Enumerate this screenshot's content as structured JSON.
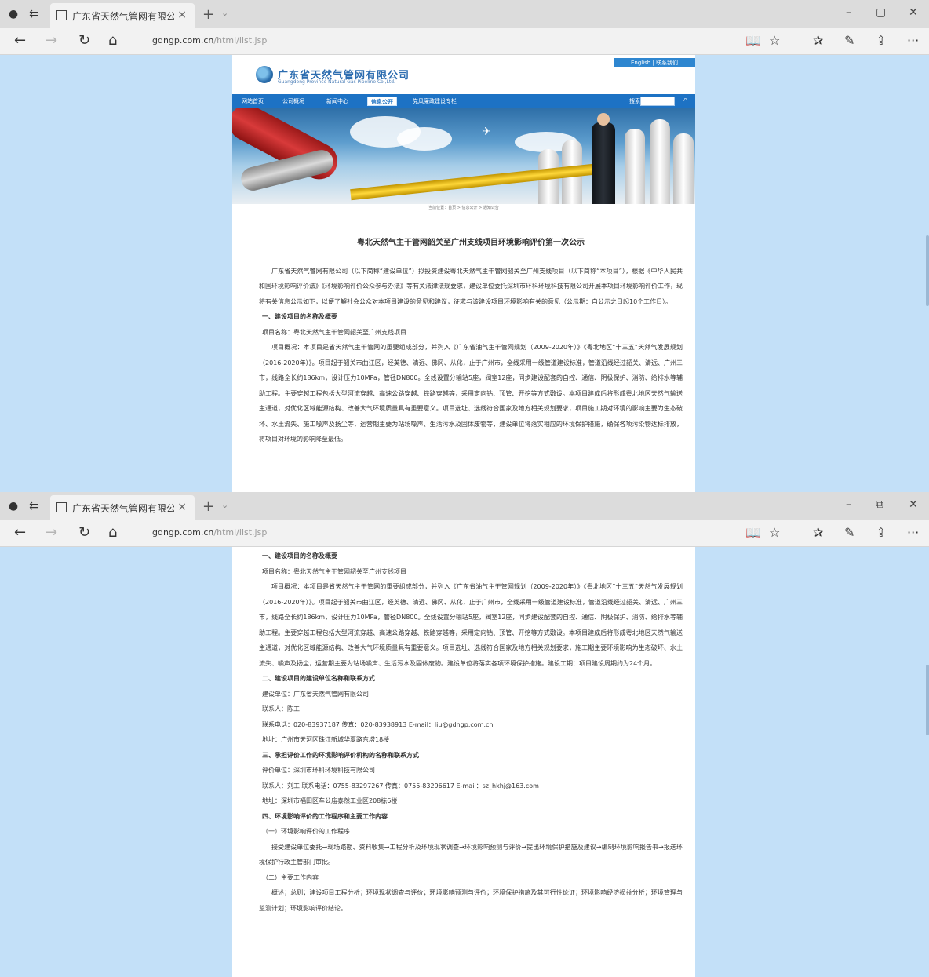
{
  "browser": {
    "tab_title": "广东省天然气管网有限公司",
    "tab_close": "×",
    "new_tab": "+",
    "tab_dropdown": "⌄",
    "url_host": "gdngp.com.cn",
    "url_path": "/html/list.jsp",
    "win_minimize": "–",
    "win_restore_top": "▢",
    "win_restore_bottom": "⧉",
    "win_close": "✕",
    "more_menu": "···"
  },
  "site": {
    "company_name": "广东省天然气管网有限公司",
    "company_en": "Guangdong Province Natural Gas Pipeline Co.,Ltd.",
    "top_link": "English  |  联系我们",
    "nav": [
      "网站首页",
      "公司概况",
      "新闻中心",
      "信息公开",
      "党风廉政建设专栏"
    ],
    "search_label": "搜索",
    "banner_caption": "当前位置：首页 > 信息公开 > 通知公告"
  },
  "article": {
    "title": "粤北天然气主干管网韶关至广州支线项目环境影响评价第一次公示",
    "intro": "广东省天然气管网有限公司（以下简称“建设单位”）拟投资建设粤北天然气主干管网韶关至广州支线项目（以下简称“本项目”），根据《中华人民共和国环境影响评价法》《环境影响评价公众参与办法》等有关法律法规要求，建设单位委托深圳市环科环境科技有限公司开展本项目环境影响评价工作，现将有关信息公示如下，以便了解社会公众对本项目建设的意见和建议，征求与该建设项目环境影响有关的意见（公示期：自公示之日起10个工作日）。",
    "sec1_heading": "一、建设项目的名称及概要",
    "project_name": "项目名称：粤北天然气主干管网韶关至广州支线项目",
    "project_summary": "项目概况：本项目是省天然气主干管网的重要组成部分，并列入《广东省油气主干管网规划（2009-2020年）》《粤北地区“十三五”天然气发展规划（2016-2020年）》。项目起于韶关市曲江区，经英德、清远、佛冈、从化，止于广州市，全线采用一级管道建设标准，管道沿线经过韶关、清远、广州三市，线路全长约186km，设计压力10MPa，管径DN800。全线设置分输站5座，阀室12座，同步建设配套的自控、通信、阴极保护、消防、给排水等辅助工程。主要穿越工程包括大型河流穿越、高速公路穿越、铁路穿越等，采用定向钻、顶管、开挖等方式敷设。本项目建成后将形成粤北地区天然气输送主通道，对优化区域能源结构、改善大气环境质量具有重要意义。项目选址、选线符合国家及地方相关规划要求，项目施工期对环境的影响主要为生态破坏、水土流失、施工噪声及扬尘等，运营期主要为站场噪声、生活污水及固体废物等，建设单位将落实相应的环境保护措施，确保各项污染物达标排放，将项目对环境的影响降至最低。",
    "project_summary_b": "项目概况：本项目是省天然气主干管网的重要组成部分，并列入《广东省油气主干管网规划（2009-2020年）》《粤北地区“十三五”天然气发展规划（2016-2020年）》。项目起于韶关市曲江区，经英德、清远、佛冈、从化，止于广州市，全线采用一级管道建设标准，管道沿线经过韶关、清远、广州三市，线路全长约186km，设计压力10MPa，管径DN800。全线设置分输站5座，阀室12座，同步建设配套的自控、通信、阴极保护、消防、给排水等辅助工程。主要穿越工程包括大型河流穿越、高速公路穿越、铁路穿越等，采用定向钻、顶管、开挖等方式敷设。本项目建成后将形成粤北地区天然气输送主通道，对优化区域能源结构、改善大气环境质量具有重要意义。项目选址、选线符合国家及地方相关规划要求，施工期主要环境影响为生态破坏、水土流失、噪声及扬尘，运营期主要为站场噪声、生活污水及固体废物。建设单位将落实各项环境保护措施。建设工期：项目建设周期约为24个月。",
    "sec2_heading": "二、建设项目的建设单位名称和联系方式",
    "owner_name": "建设单位：广东省天然气管网有限公司",
    "owner_contact": "联系人：陈工",
    "owner_phone": "联系电话：020-83937187  传真：020-83938913  E-mail：liu@gdngp.com.cn",
    "owner_address": "地址：广州市天河区珠江新城华夏路东塔18楼",
    "sec3_heading": "三、承担评价工作的环境影响评价机构的名称和联系方式",
    "eia_name": "评价单位：深圳市环科环境科技有限公司",
    "eia_contact": "联系人：刘工  联系电话：0755-83297267  传真：0755-83296617  E-mail：sz_hkhj@163.com",
    "eia_address": "地址：深圳市福田区车公庙泰然工业区208栋6楼",
    "sec4_heading": "四、环境影响评价的工作程序和主要工作内容",
    "sec4_sub1": "（一）环境影响评价的工作程序",
    "sec4_sub1_text": "接受建设单位委托→现场踏勘、资料收集→工程分析及环境现状调查→环境影响预测与评价→提出环境保护措施及建议→编制环境影响报告书→报送环境保护行政主管部门审批。",
    "sec4_sub2": "（二）主要工作内容",
    "sec4_sub2_text": "概述；总则；建设项目工程分析；环境现状调查与评价；环境影响预测与评价；环境保护措施及其可行性论证；环境影响经济损益分析；环境管理与监测计划；环境影响评价结论。"
  }
}
